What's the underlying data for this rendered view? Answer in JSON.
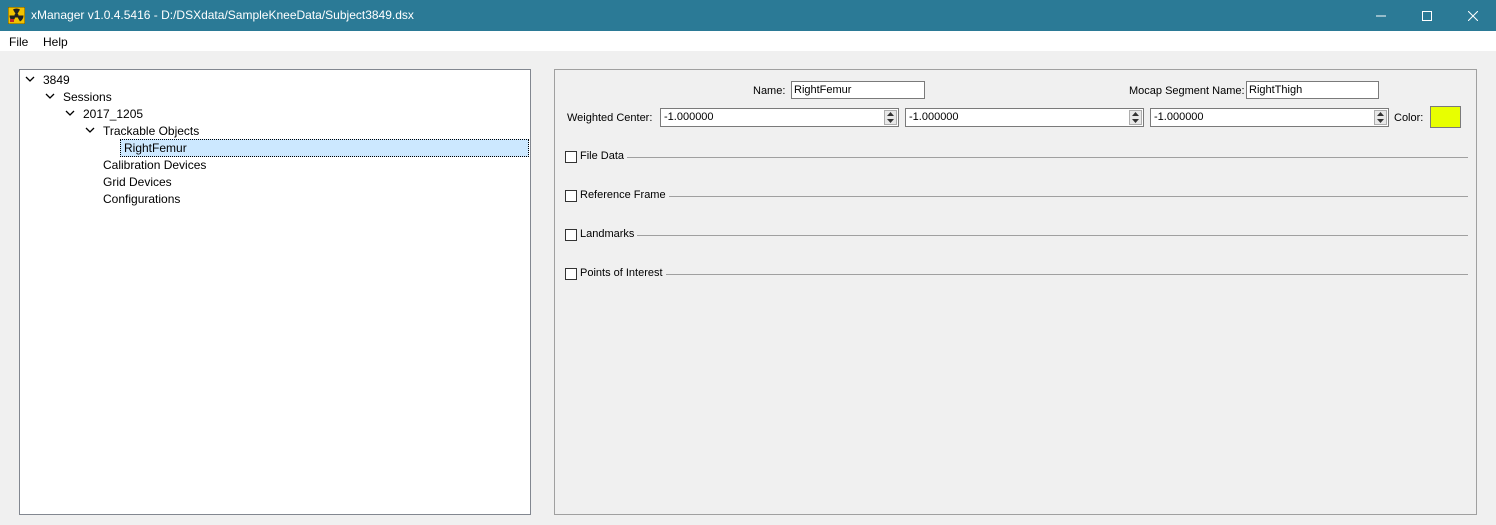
{
  "window": {
    "title": "xManager v1.0.4.5416  - D:/DSXdata/SampleKneeData/Subject3849.dsx",
    "titlebar_color": "#2b7a96"
  },
  "menu": {
    "file": "File",
    "help": "Help"
  },
  "tree": {
    "root": "3849",
    "sessions": "Sessions",
    "session_2017_1205": "2017_1205",
    "trackable_objects": "Trackable Objects",
    "right_femur": "RightFemur",
    "calibration_devices": "Calibration Devices",
    "grid_devices": "Grid Devices",
    "configurations": "Configurations"
  },
  "details": {
    "name_label": "Name:",
    "name_value": "RightFemur",
    "mocap_label": "Mocap Segment Name:",
    "mocap_value": "RightThigh",
    "weighted_center_label": "Weighted Center:",
    "weighted_center_x": "-1.000000",
    "weighted_center_y": "-1.000000",
    "weighted_center_z": "-1.000000",
    "color_label": "Color:",
    "color_value": "#e8ff00",
    "groups": {
      "file_data": "File Data",
      "reference_frame": "Reference Frame",
      "landmarks": "Landmarks",
      "points_of_interest": "Points of Interest"
    }
  }
}
